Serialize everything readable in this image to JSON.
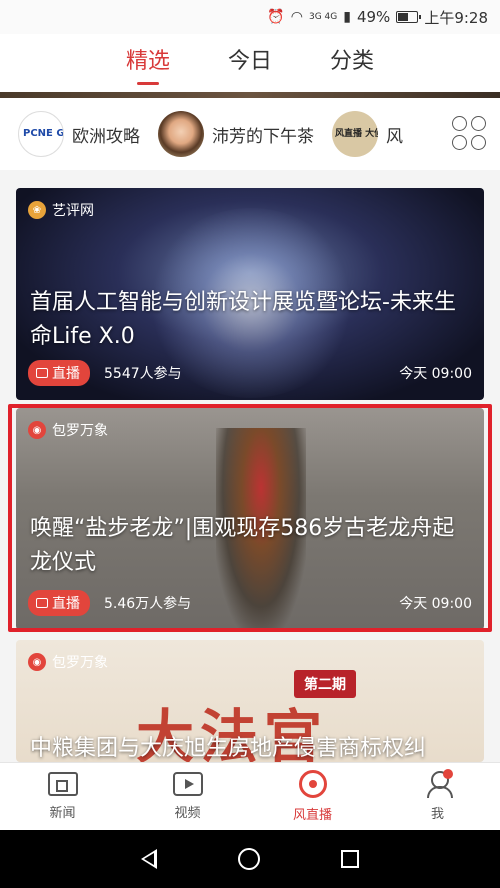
{
  "status_bar": {
    "network": "3G 4G",
    "battery_percent": "49%",
    "battery_level": 0.49,
    "time": "上午9:28",
    "icons": [
      "alarm-icon",
      "wifi-icon",
      "signal-icon",
      "battery-icon"
    ]
  },
  "top_tabs": [
    {
      "label": "精选",
      "active": true
    },
    {
      "label": "今日",
      "active": false
    },
    {
      "label": "分类",
      "active": false
    }
  ],
  "channels": [
    {
      "label": "欧洲攻略",
      "avatar_text": "PCNE GO"
    },
    {
      "label": "沛芳的下午茶",
      "avatar_text": ""
    },
    {
      "label": "风",
      "avatar_text": "风直播 大侦探"
    }
  ],
  "cards": [
    {
      "source": "艺评网",
      "title": "首届人工智能与创新设计展览暨论坛-未来生命Life X.0",
      "live_label": "直播",
      "participants": "5547人参与",
      "time": "今天 09:00"
    },
    {
      "source": "包罗万象",
      "title": "唤醒“盐步老龙”|围观现存586岁古老龙舟起龙仪式",
      "live_label": "直播",
      "participants": "5.46万人参与",
      "time": "今天 09:00",
      "highlighted": true
    },
    {
      "source": "包罗万象",
      "title": "中粮集团与大庆旭生房地产侵害商标权纠",
      "image_text": "大法官",
      "issue_badge": "第二期"
    }
  ],
  "bottom_nav": [
    {
      "label": "新闻",
      "icon": "news-icon",
      "active": false
    },
    {
      "label": "视频",
      "icon": "video-icon",
      "active": false
    },
    {
      "label": "风直播",
      "icon": "live-icon",
      "active": true
    },
    {
      "label": "我",
      "icon": "profile-icon",
      "active": false,
      "has_dot": true
    }
  ],
  "colors": {
    "accent": "#d83a3a",
    "live_badge": "#e2453c",
    "highlight_border": "#e0212b"
  }
}
